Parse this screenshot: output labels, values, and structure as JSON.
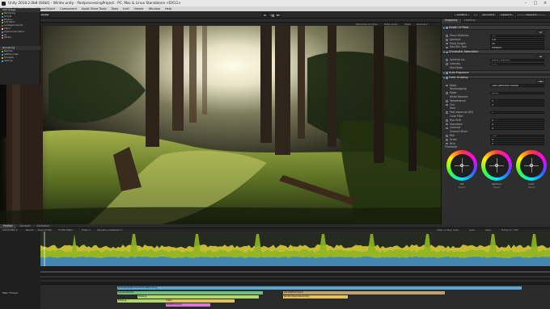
{
  "window": {
    "title": "Unity 2018.2.0b8 (64bit) - Winter.unity - PostprocessingProject - PC, Mac & Linux Standalone <DX11>"
  },
  "menu": [
    "File",
    "Edit",
    "Assets",
    "GameObject",
    "Component",
    "Asset Store Tools",
    "Tools",
    "Jcell",
    "Viewer",
    "Window",
    "Help"
  ],
  "toolbar": {
    "pivot_label": "Pivot",
    "global_label": "Global",
    "collab_label": "Collab ▾",
    "account_label": "Account ▾",
    "layers_label": "Layers ▾",
    "layout_label": "Layout ▾"
  },
  "scene": {
    "tabs": [
      "Scene",
      "Game"
    ],
    "display_label": "Display 1",
    "aspect_label": "Free Aspect",
    "scale_label": "Scale",
    "maximize_label": "Maximize On Play",
    "mute_label": "Mute Audio",
    "stats_label": "Stats",
    "gizmos_label": "Gizmos ▾"
  },
  "inspector": {
    "tabs": [
      "Inspector",
      "Lighting"
    ],
    "sections": [
      {
        "title": "Depth Of Field",
        "enabled": true,
        "all_label": "All",
        "rows": [
          {
            "label": "Focus Distance",
            "value": "10"
          },
          {
            "label": "Aperture",
            "value": "5.6"
          },
          {
            "label": "Focal Length",
            "value": "50"
          },
          {
            "label": "Max Blur Size",
            "value": "Medium"
          }
        ]
      },
      {
        "title": "Chromatic Aberration",
        "enabled": true,
        "all_label": "All",
        "rows": [
          {
            "label": "Spectral Lut",
            "value": "None (Texture)"
          },
          {
            "label": "Intensity",
            "value": "0.07"
          },
          {
            "label": "Fast Mode",
            "value": ""
          }
        ]
      },
      {
        "title": "Auto Exposure",
        "enabled": true
      },
      {
        "title": "Color Grading",
        "enabled": true,
        "all_label": "All",
        "rows": [
          {
            "label": "Mode",
            "value": "Low Definition Range"
          },
          {
            "label": "Tonemapping",
            "value": ""
          },
          {
            "label": "Mode",
            "value": "None"
          },
          {
            "label": "White Balance",
            "value": ""
          },
          {
            "label": "Temperature",
            "value": "0"
          },
          {
            "label": "Tint",
            "value": "0"
          },
          {
            "label": "Tone",
            "value": ""
          },
          {
            "label": "Post-exposure (EV)",
            "value": "0"
          },
          {
            "label": "Color Filter",
            "value": ""
          },
          {
            "label": "Hue Shift",
            "value": "0"
          },
          {
            "label": "Saturation",
            "value": "0"
          },
          {
            "label": "Contrast",
            "value": "0"
          },
          {
            "label": "Channel Mixer",
            "value": ""
          },
          {
            "label": "Red",
            "value": "100"
          },
          {
            "label": "Green",
            "value": "0"
          },
          {
            "label": "Blue",
            "value": "0"
          }
        ],
        "trackballs_label": "Trackballs",
        "wheels": [
          "Lift",
          "Gamma",
          "Gain"
        ],
        "reset_label": "Reset"
      }
    ]
  },
  "profiler": {
    "tabs": [
      "Profiler",
      "Console",
      "Animator"
    ],
    "toolbar": [
      "Add Profiler ▾",
      "Record",
      "Deep Profile",
      "Profile Editor",
      "Editor ▾",
      "Allocation Callstacks ▾",
      "Clear on Play",
      "Clear",
      "Load",
      "Save",
      "Frame: 6 / 300"
    ],
    "modules": [
      {
        "title": "CPU Usage",
        "items": [
          {
            "label": "Rendering",
            "color": "#7fb33e"
          },
          {
            "label": "Scripts",
            "color": "#4a90d9"
          },
          {
            "label": "Physics",
            "color": "#e0a13a"
          },
          {
            "label": "Animation",
            "color": "#2fb7a8"
          },
          {
            "label": "GarbageCollector",
            "color": "#c64a4a"
          },
          {
            "label": "VSync",
            "color": "#e5e05c"
          },
          {
            "label": "Global Illumination",
            "color": "#9a6fd1"
          },
          {
            "label": "UI",
            "color": "#bf6fbf"
          },
          {
            "label": "Others",
            "color": "#8a8a8a"
          }
        ]
      },
      {
        "title": "Rendering",
        "items": [
          {
            "label": "Batches",
            "color": "#7fb33e"
          },
          {
            "label": "SetPass Calls",
            "color": "#4a90d9"
          },
          {
            "label": "Triangles",
            "color": "#e0a13a"
          },
          {
            "label": "Vertices",
            "color": "#2fb7a8"
          }
        ]
      }
    ],
    "timeline_thread": "Main Thread",
    "timeline_blocks": [
      {
        "label": "PostLateUpdate.FinishFrameRendering",
        "color": "#5aa7d6"
      },
      {
        "label": "Camera.Render",
        "color": "#6ec07a"
      },
      {
        "label": "Drawing",
        "color": "#b0d86a"
      },
      {
        "label": "Render.OpaqueGeometry",
        "color": "#e0c35a"
      },
      {
        "label": "PostProcessing",
        "color": "#d67ad6"
      },
      {
        "label": "Gfx.WaitForPresent",
        "color": "#c6a06a"
      }
    ]
  },
  "colors": {
    "accent": "#5a8fd8",
    "chart_green": "#8fb521",
    "chart_blue": "#3c7fc0"
  }
}
